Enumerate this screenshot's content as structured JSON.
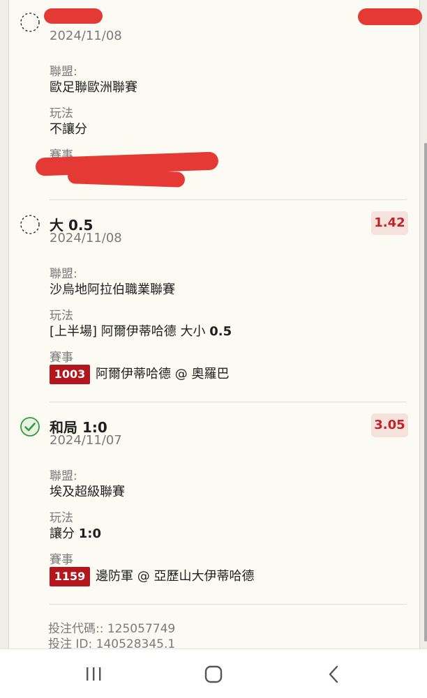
{
  "labels": {
    "league": "聯盟:",
    "bet_type": "玩法",
    "match": "賽事"
  },
  "bets": [
    {
      "selection": "",
      "date": "2024/11/08",
      "odds": "",
      "status": "pending",
      "league": "歐足聯歐洲聯賽",
      "bet_type": "不讓分",
      "match_code": "",
      "match": ""
    },
    {
      "selection": "大 0.5",
      "date": "2024/11/08",
      "odds": "1.42",
      "status": "pending",
      "league": "沙烏地阿拉伯職業聯賽",
      "bet_type_prefix": "[上半場] 阿爾伊蒂哈德 大小 ",
      "bet_type_value": "0.5",
      "match_code": "1003",
      "match": "阿爾伊蒂哈德 @ 奧羅巴"
    },
    {
      "selection": "和局 1:0",
      "date": "2024/11/07",
      "odds": "3.05",
      "status": "won",
      "league": "埃及超級聯賽",
      "bet_type_prefix": "讓分 ",
      "bet_type_value": "1:0",
      "match_code": "1159",
      "match": "邊防軍 @ 亞歷山大伊蒂哈德"
    }
  ],
  "footer": {
    "bet_code": "投注代碼:: 125057749",
    "bet_id": "投注 ID: 140528345.1"
  },
  "colors": {
    "card_bg": "#fbfbf3",
    "odds_text": "#c0242a",
    "odds_bg": "#f5e2dd",
    "code_badge": "#b3171d",
    "won_icon": "#3a9a3f",
    "redaction": "#e53935"
  },
  "navbar": {
    "icons": [
      "recent-apps-icon",
      "home-icon",
      "back-icon"
    ]
  }
}
